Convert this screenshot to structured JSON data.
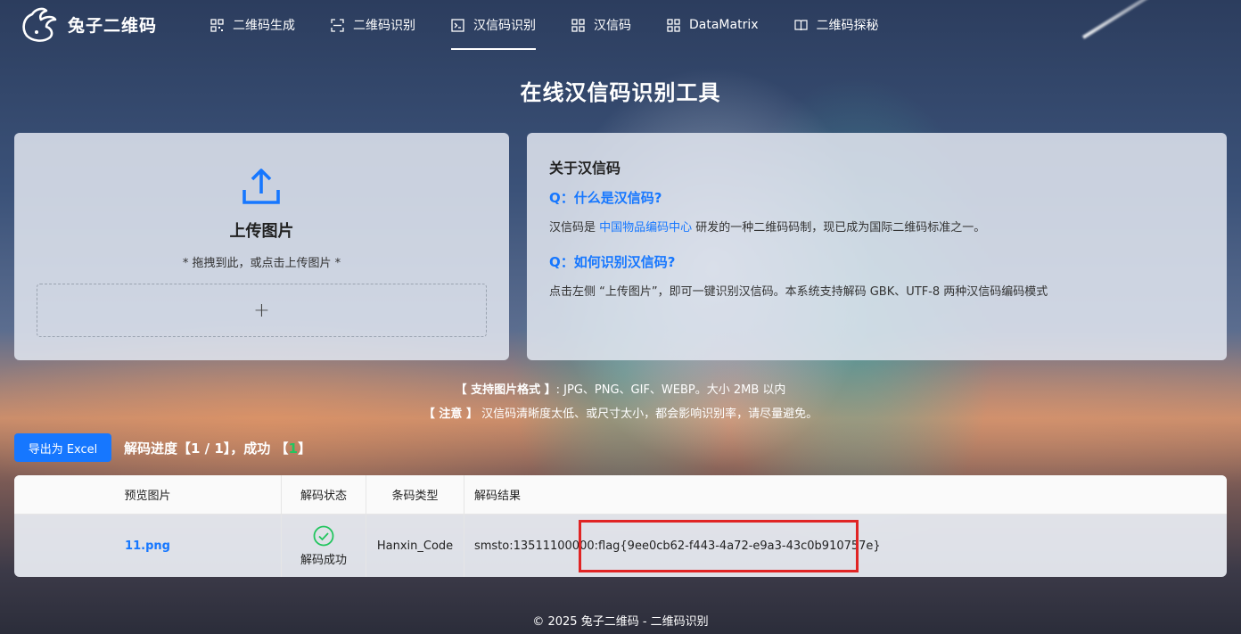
{
  "header": {
    "brand": "兔子二维码",
    "nav": [
      {
        "label": "二维码生成",
        "icon": "qrcode-icon",
        "active": false
      },
      {
        "label": "二维码识别",
        "icon": "scan-icon",
        "active": false
      },
      {
        "label": "汉信码识别",
        "icon": "terminal-icon",
        "active": true
      },
      {
        "label": "汉信码",
        "icon": "grid-icon",
        "active": false
      },
      {
        "label": "DataMatrix",
        "icon": "grid-icon",
        "active": false
      },
      {
        "label": "二维码探秘",
        "icon": "book-icon",
        "active": false
      }
    ]
  },
  "page": {
    "title": "在线汉信码识别工具"
  },
  "upload": {
    "title": "上传图片",
    "hint": "* 拖拽到此，或点击上传图片 *",
    "add": "+"
  },
  "about": {
    "title": "关于汉信码",
    "q1": "Q：什么是汉信码?",
    "a1_pre": "汉信码是 ",
    "a1_link": "中国物品编码中心",
    "a1_post": " 研发的一种二维码码制，现已成为国际二维码标准之一。",
    "q2": "Q：如何识别汉信码?",
    "a2": "点击左侧 “上传图片”，即可一键识别汉信码。本系统支持解码 GBK、UTF-8 两种汉信码编码模式"
  },
  "notes": {
    "formats_label": "【 支持图片格式 】",
    "formats": ": JPG、PNG、GIF、WEBP。大小 2MB 以内",
    "notice_label": "【 注意 】",
    "notice": "汉信码清晰度太低、或尺寸太小，都会影响识别率，请尽量避免。"
  },
  "toolbar": {
    "export_label": "导出为 Excel",
    "progress_pre": "解码进度【1 / 1】，成功 【",
    "progress_ok": "1",
    "progress_post": "】"
  },
  "table": {
    "headers": [
      "预览图片",
      "解码状态",
      "条码类型",
      "解码结果"
    ],
    "rows": [
      {
        "file": "11.png",
        "status": "解码成功",
        "type": "Hanxin_Code",
        "result": "smsto:13511100000:flag{9ee0cb62-f443-4a72-e9a3-43c0b910757e}"
      }
    ]
  },
  "footer": {
    "text": "© 2025 兔子二维码 - 二维码识别"
  },
  "colors": {
    "primary": "#1677ff",
    "success": "#22c55e",
    "highlight": "#e02424"
  }
}
